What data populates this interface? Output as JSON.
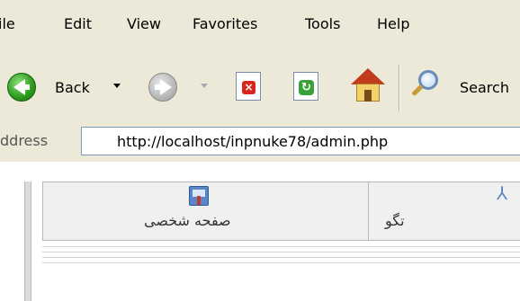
{
  "menubar": {
    "items": [
      {
        "label": "File",
        "visible": "ile"
      },
      {
        "label": "Edit"
      },
      {
        "label": "View"
      },
      {
        "label": "Favorites"
      },
      {
        "label": "Tools"
      },
      {
        "label": "Help"
      }
    ]
  },
  "toolbar": {
    "back_label": "Back",
    "search_label": "Search",
    "icons": [
      "back-arrow-icon",
      "forward-arrow-icon",
      "stop-icon",
      "refresh-icon",
      "home-icon",
      "search-icon"
    ]
  },
  "address": {
    "label": "ddress",
    "url": "http://localhost/inpnuke78/admin.php"
  },
  "admin_panel": {
    "cells": [
      {
        "label": "صفحه شخصی",
        "icon": "admin-tools-icon"
      },
      {
        "label": "تگو",
        "icon": "admin-icon-partial"
      }
    ]
  },
  "colors": {
    "chrome": "#ece9d8",
    "address_border": "#7f9db9",
    "cell_bg": "#f0f0f0",
    "cell_border": "#b8b8b8",
    "accent_blue": "#5b86c9"
  }
}
